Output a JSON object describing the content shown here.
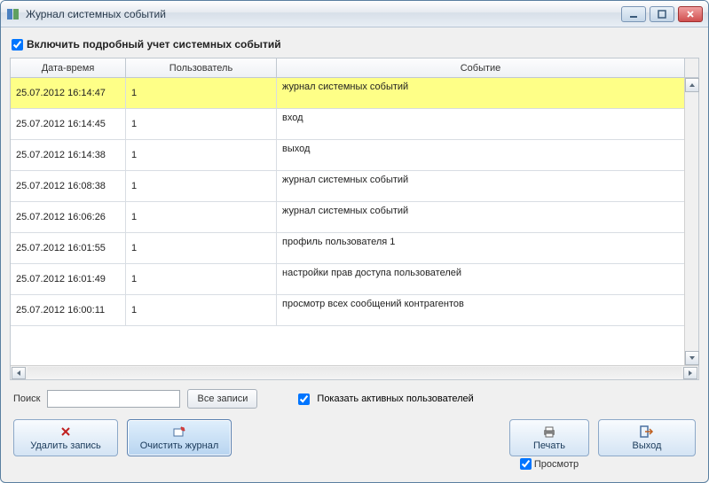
{
  "window": {
    "title": "Журнал системных событий"
  },
  "detail_checkbox": {
    "label": "Включить подробный учет системных событий",
    "checked": true
  },
  "table": {
    "headers": {
      "datetime": "Дата-время",
      "user": "Пользователь",
      "event": "Событие"
    },
    "rows": [
      {
        "datetime": "25.07.2012 16:14:47",
        "user": "1",
        "event": "журнал системных событий",
        "selected": true
      },
      {
        "datetime": "25.07.2012 16:14:45",
        "user": "1",
        "event": "вход",
        "selected": false
      },
      {
        "datetime": "25.07.2012 16:14:38",
        "user": "1",
        "event": "выход",
        "selected": false
      },
      {
        "datetime": "25.07.2012 16:08:38",
        "user": "1",
        "event": "журнал системных событий",
        "selected": false
      },
      {
        "datetime": "25.07.2012 16:06:26",
        "user": "1",
        "event": "журнал системных событий",
        "selected": false
      },
      {
        "datetime": "25.07.2012 16:01:55",
        "user": "1",
        "event": "профиль пользователя 1",
        "selected": false
      },
      {
        "datetime": "25.07.2012 16:01:49",
        "user": "1",
        "event": "настройки прав доступа пользователей",
        "selected": false
      },
      {
        "datetime": "25.07.2012 16:00:11",
        "user": "1",
        "event": "просмотр всех сообщений контрагентов",
        "selected": false
      }
    ]
  },
  "search": {
    "label": "Поиск",
    "value": "",
    "all_button": "Все записи"
  },
  "active_users": {
    "label": "Показать активных пользователей",
    "checked": true
  },
  "buttons": {
    "delete": "Удалить запись",
    "clear": "Очистить журнал",
    "print": "Печать",
    "exit": "Выход"
  },
  "preview": {
    "label": "Просмотр",
    "checked": true
  }
}
